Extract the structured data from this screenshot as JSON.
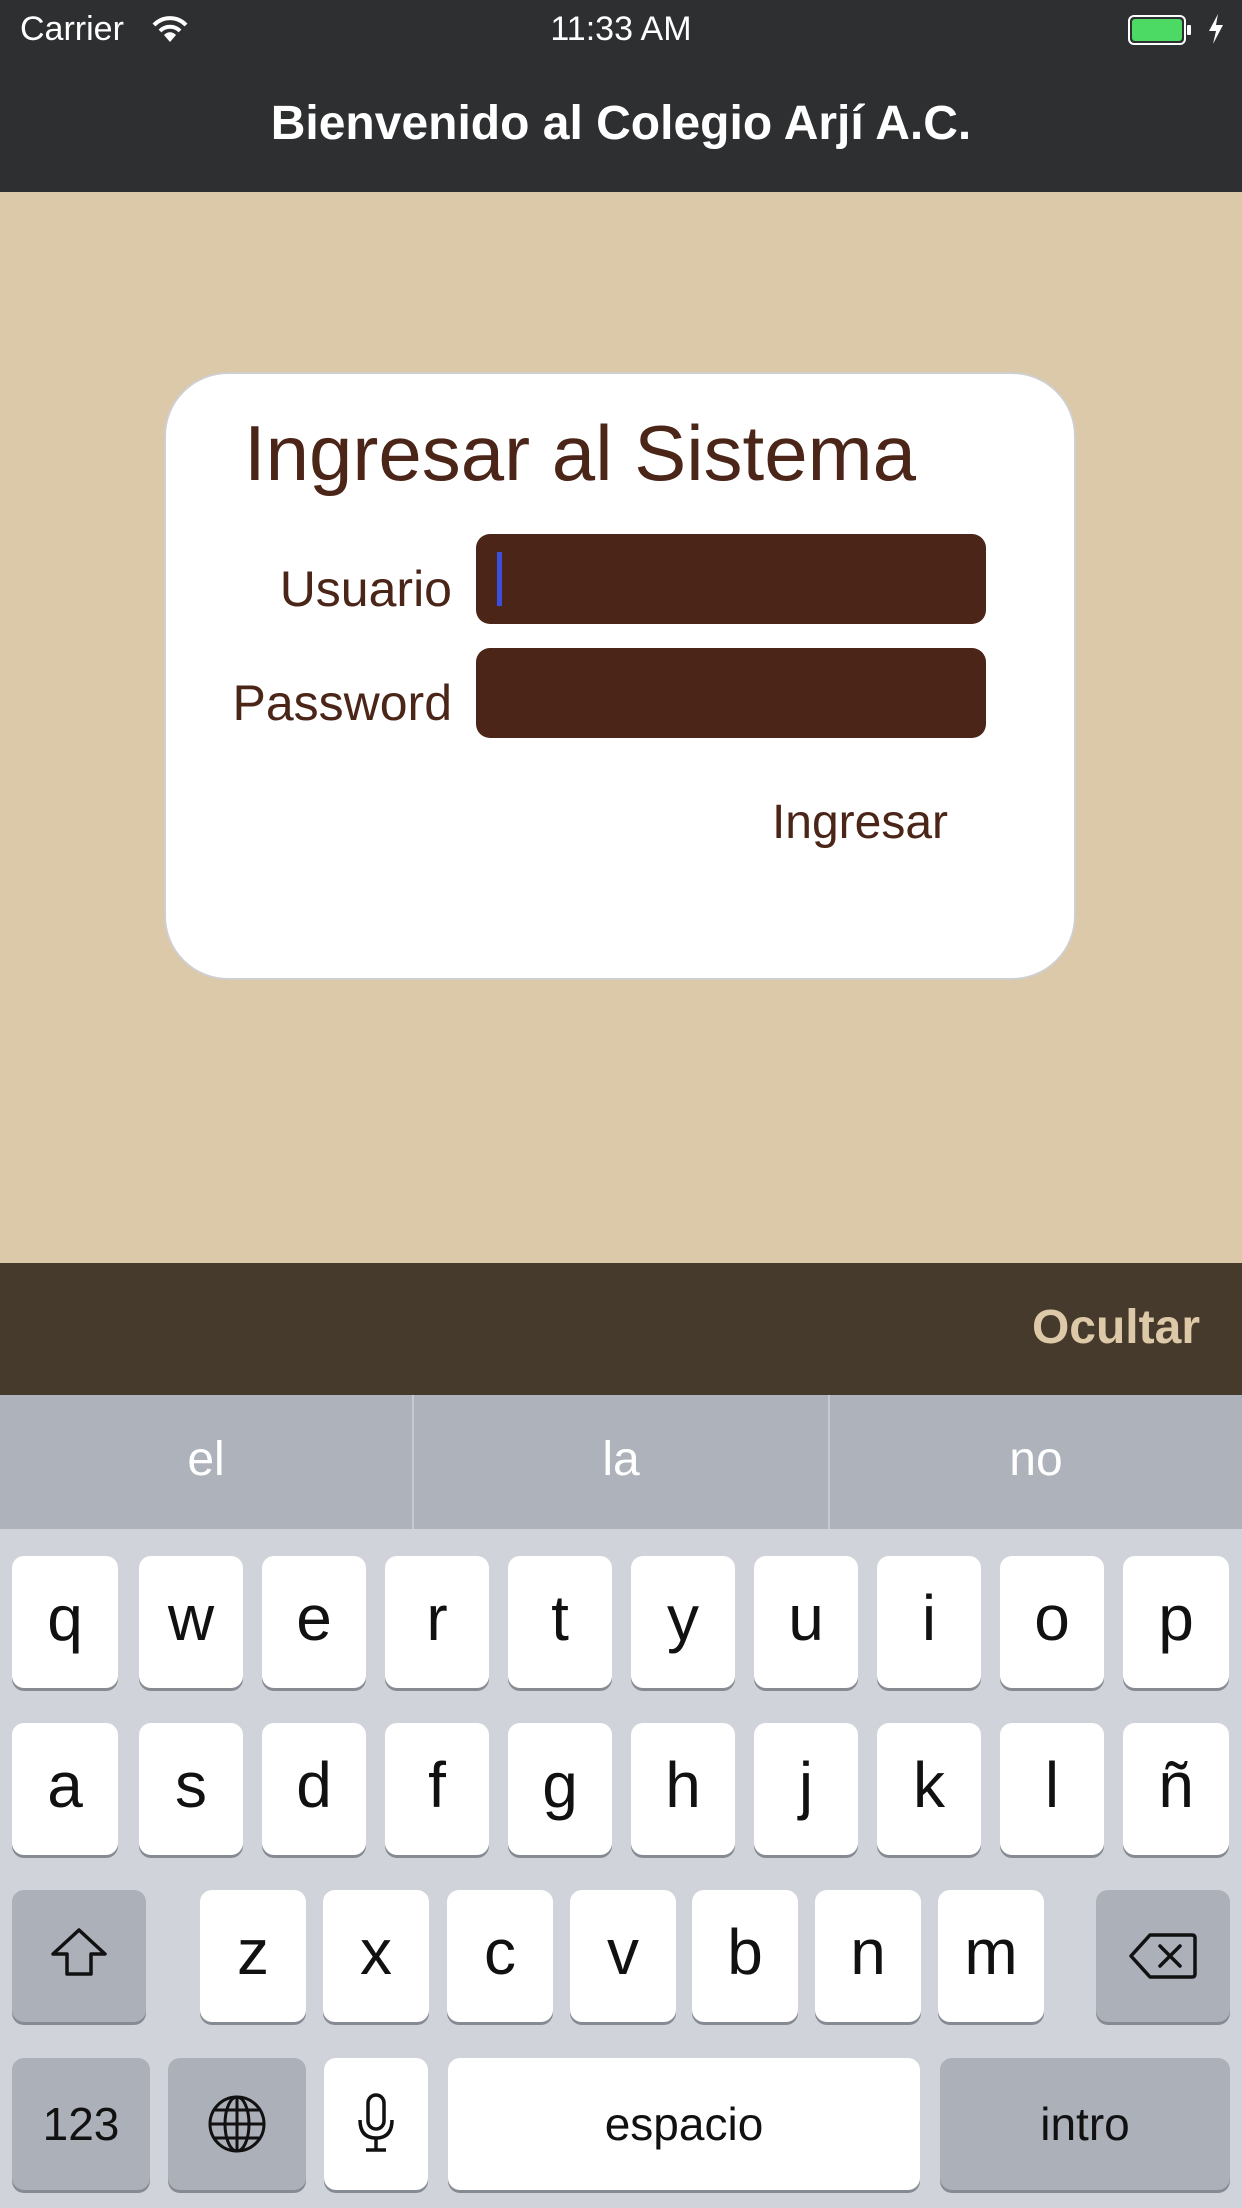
{
  "status_bar": {
    "carrier": "Carrier",
    "time": "11:33 AM"
  },
  "nav": {
    "title": "Bienvenido al Colegio Arjí A.C."
  },
  "login": {
    "title": "Ingresar al Sistema",
    "user_label": "Usuario",
    "password_label": "Password",
    "user_value": "",
    "password_value": "",
    "submit_label": "Ingresar"
  },
  "accessory": {
    "hide_label": "Ocultar"
  },
  "keyboard": {
    "suggestions": [
      "el",
      "la",
      "no"
    ],
    "row1": [
      "q",
      "w",
      "e",
      "r",
      "t",
      "y",
      "u",
      "i",
      "o",
      "p"
    ],
    "row2": [
      "a",
      "s",
      "d",
      "f",
      "g",
      "h",
      "j",
      "k",
      "l",
      "ñ"
    ],
    "row3": [
      "z",
      "x",
      "c",
      "v",
      "b",
      "n",
      "m"
    ],
    "numbers_label": "123",
    "space_label": "espacio",
    "return_label": "intro"
  },
  "colors": {
    "background": "#dbc9a9",
    "nav_bar": "#2e2f31",
    "field_fill": "#4a2518",
    "text_brown": "#4a2518",
    "accessory_bar": "#463a2d",
    "accessory_text": "#ddc9a8",
    "battery": "#4cd964"
  }
}
